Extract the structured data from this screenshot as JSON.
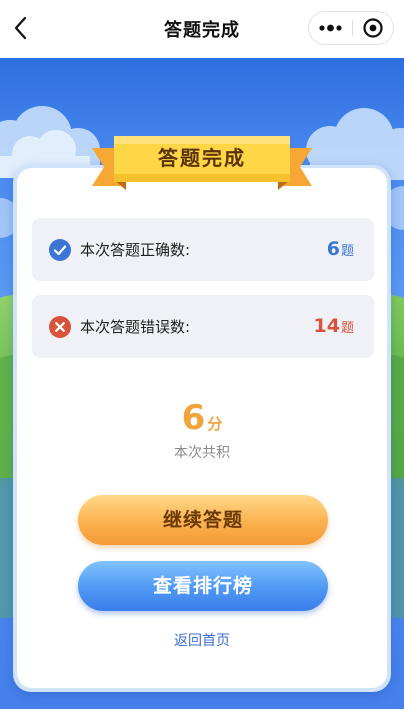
{
  "nav": {
    "title": "答题完成"
  },
  "banner": {
    "title": "答题完成"
  },
  "results": {
    "correct": {
      "label": "本次答题正确数:",
      "value": "6",
      "unit": "题",
      "icon": "check-circle-icon",
      "color": "#3b76d4"
    },
    "wrong": {
      "label": "本次答题错误数:",
      "value": "14",
      "unit": "题",
      "icon": "x-circle-icon",
      "color": "#d9533c"
    }
  },
  "score": {
    "value": "6",
    "unit": "分",
    "caption": "本次共积"
  },
  "actions": {
    "continue_label": "继续答题",
    "ranking_label": "查看排行榜",
    "home_label": "返回首页"
  },
  "colors": {
    "accent_orange": "#f2a43a",
    "accent_blue": "#3b6fd0",
    "background_blue": "#4c8cf0"
  }
}
